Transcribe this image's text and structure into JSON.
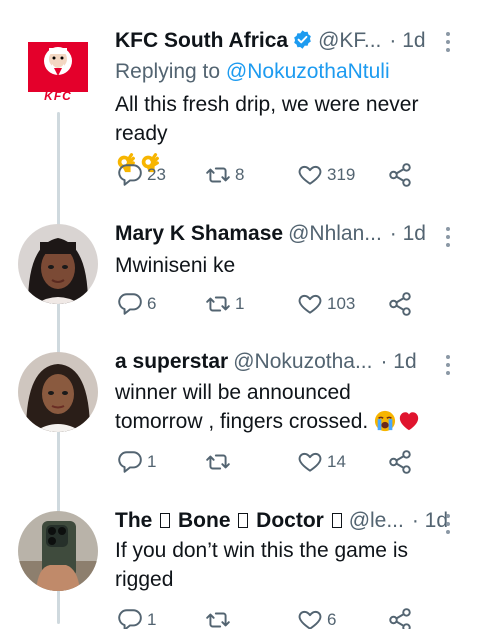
{
  "tweets": [
    {
      "name": "KFC South Africa",
      "handle": "@KF...",
      "time": "· 1d",
      "verified": true,
      "reply_prefix": "Replying to ",
      "reply_mention": "@NokuzothaNtuli",
      "text": "All this fresh drip, we were never ready",
      "text_emojis": [
        "ok-hand-emoji",
        "ok-hand-emoji"
      ],
      "replies": "23",
      "retweets": "8",
      "likes": "319",
      "avatar_text": "KFC"
    },
    {
      "name": "Mary K Shamase",
      "handle": "@Nhlan...",
      "time": "· 1d",
      "text": "Mwiniseni ke",
      "replies": "6",
      "retweets": "1",
      "likes": "103"
    },
    {
      "name": "a superstar",
      "handle": "@Nokuzotha...",
      "time": "· 1d",
      "text_line1": "winner will be announced",
      "text_line2": "tomorrow , fingers crossed.",
      "text_emojis": [
        "crying-face-emoji",
        "red-heart-emoji"
      ],
      "replies": "1",
      "retweets": "",
      "likes": "14"
    },
    {
      "name_parts": [
        "The ",
        " Bone ",
        " Doctor "
      ],
      "handle": "@le...",
      "time": "· 1d",
      "text_line1": "If you don’t win this the game is",
      "text_line2": "rigged",
      "replies": "1",
      "retweets": "",
      "likes": "6"
    }
  ],
  "icons": {
    "reply": "reply-icon",
    "retweet": "retweet-icon",
    "like": "heart-icon",
    "share": "share-icon",
    "more": "more-vertical-icon",
    "verified": "verified-badge-icon"
  },
  "colors": {
    "link": "#1d9bf0",
    "secondary_text": "#536471",
    "verified": "#1d9bf0",
    "kfc_red": "#e4002b",
    "thread_line": "#cfd9de"
  }
}
